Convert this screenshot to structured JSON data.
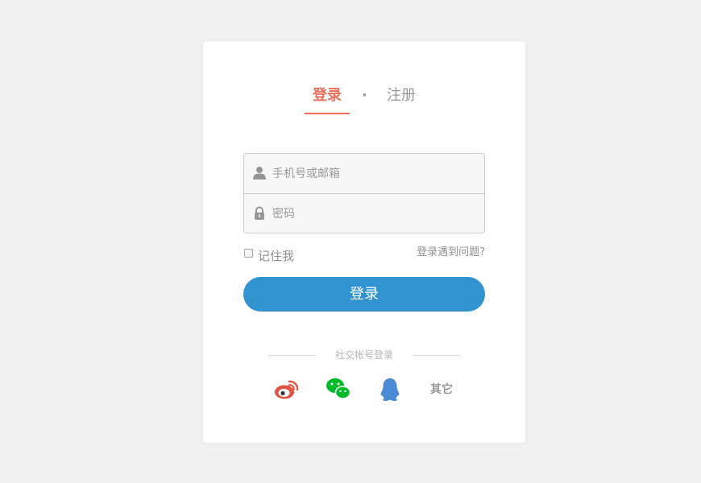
{
  "tabs": {
    "login_label": "登录",
    "separator": "·",
    "register_label": "注册"
  },
  "form": {
    "account_placeholder": "手机号或邮箱",
    "password_placeholder": "密码",
    "remember_label": "记住我",
    "trouble_link": "登录遇到问题?",
    "submit_label": "登录"
  },
  "social": {
    "title": "社交帐号登录",
    "items": [
      {
        "icon": "weibo-icon",
        "color": "#e05244"
      },
      {
        "icon": "wechat-icon",
        "color": "#00bb29"
      },
      {
        "icon": "qq-icon",
        "color": "#498ad5"
      }
    ],
    "other_label": "其它"
  },
  "colors": {
    "accent": "#ea6f5a",
    "primary_button": "#3194d0",
    "background": "#f1f1f1"
  }
}
